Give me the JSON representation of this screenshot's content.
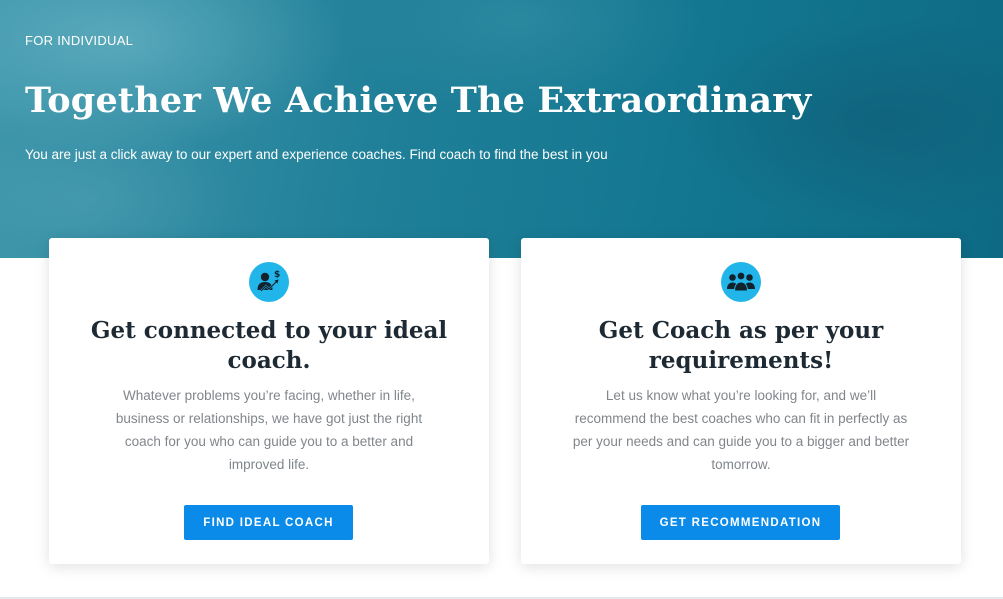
{
  "hero": {
    "eyebrow": "FOR INDIVIDUAL",
    "title": "Together We Achieve The Extraordinary",
    "subtitle": "You are just a click away to our expert and experience coaches. Find coach to find the best in you"
  },
  "cards": [
    {
      "icon": "coach-growth-icon",
      "title": "Get connected to your ideal coach.",
      "text": "Whatever problems you’re facing, whether in life, business or relationships, we have got just the right coach for you who can guide you to a better and improved life.",
      "button_label": "FIND IDEAL COACH"
    },
    {
      "icon": "group-people-icon",
      "title": "Get Coach as per your requirements!",
      "text": "Let us know what you’re looking for, and we’ll recommend the best coaches who can fit in perfectly as per your needs and can guide you to a bigger and better tomorrow.",
      "button_label": "GET RECOMMENDATION"
    }
  ],
  "colors": {
    "hero_bg": "#1f7f98",
    "accent_button": "#0a8bea",
    "icon_bg": "#21b5ea",
    "heading": "#1e2a33",
    "body_text": "#80868b"
  }
}
